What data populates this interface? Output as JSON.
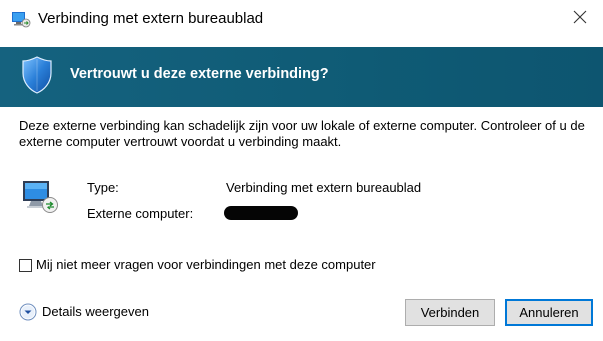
{
  "window": {
    "title": "Verbinding met extern bureaublad"
  },
  "banner": {
    "heading": "Vertrouwt u deze externe verbinding?"
  },
  "description": {
    "line1": "Deze externe verbinding kan schadelijk zijn voor uw lokale of externe computer. Controleer of u de",
    "line2": "externe computer vertrouwt voordat u verbinding maakt."
  },
  "info": {
    "type_label": "Type:",
    "type_value": "Verbinding met extern bureaublad",
    "computer_label": "Externe computer:",
    "computer_value_redacted": true
  },
  "checkbox": {
    "label": "Mij niet meer vragen voor verbindingen met deze computer",
    "checked": false
  },
  "details": {
    "label": "Details weergeven"
  },
  "buttons": {
    "connect": "Verbinden",
    "cancel": "Annuleren"
  },
  "icons": {
    "app": "remote-desktop-icon",
    "close": "close-icon",
    "banner": "shield-icon",
    "computer": "remote-computer-icon",
    "details": "chevron-down-circle-icon"
  },
  "colors": {
    "banner": "#0f5b75",
    "banner_text": "#ffffff",
    "button_bg": "#e1e1e1",
    "focus_border": "#0078d7"
  }
}
